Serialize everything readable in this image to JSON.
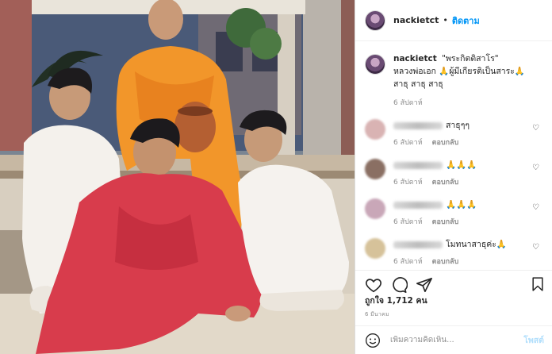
{
  "header": {
    "username": "nackietct",
    "separator": "•",
    "follow_label": "ติดตาม"
  },
  "caption": {
    "username": "nackietct",
    "text_line1": "\"พระกิตติสาโร\"",
    "text_line2": "หลวงพ่อเอก 🙏ผู้มีเกียรติเป็นสาระ🙏",
    "text_line3": "สาธุ สาธุ สาธุ",
    "time": "6 สัปดาห์"
  },
  "comments": [
    {
      "text": "สาธุๆๆ",
      "time": "6 สัปดาห์",
      "reply": "ตอบกลับ",
      "avatar_color": "#d9b3b3"
    },
    {
      "text": "🙏🙏🙏",
      "time": "6 สัปดาห์",
      "reply": "ตอบกลับ",
      "avatar_color": "#8a6f63"
    },
    {
      "text": "🙏🙏🙏",
      "time": "6 สัปดาห์",
      "reply": "ตอบกลับ",
      "avatar_color": "#c9a7b8"
    },
    {
      "text": "โมทนาสาธุค่ะ🙏",
      "time": "6 สัปดาห์",
      "reply": "ตอบกลับ",
      "avatar_color": "#d6c29a"
    }
  ],
  "likes_text": "ถูกใจ 1,712 คน",
  "date_text": "6 มีนาคม",
  "add_comment": {
    "placeholder": "เพิ่มความคิดเห็น...",
    "post_label": "โพสต์"
  },
  "icons": {
    "like": "heart-icon",
    "comment": "comment-icon",
    "share": "share-icon",
    "save": "bookmark-icon",
    "emoji": "smiley-icon"
  }
}
